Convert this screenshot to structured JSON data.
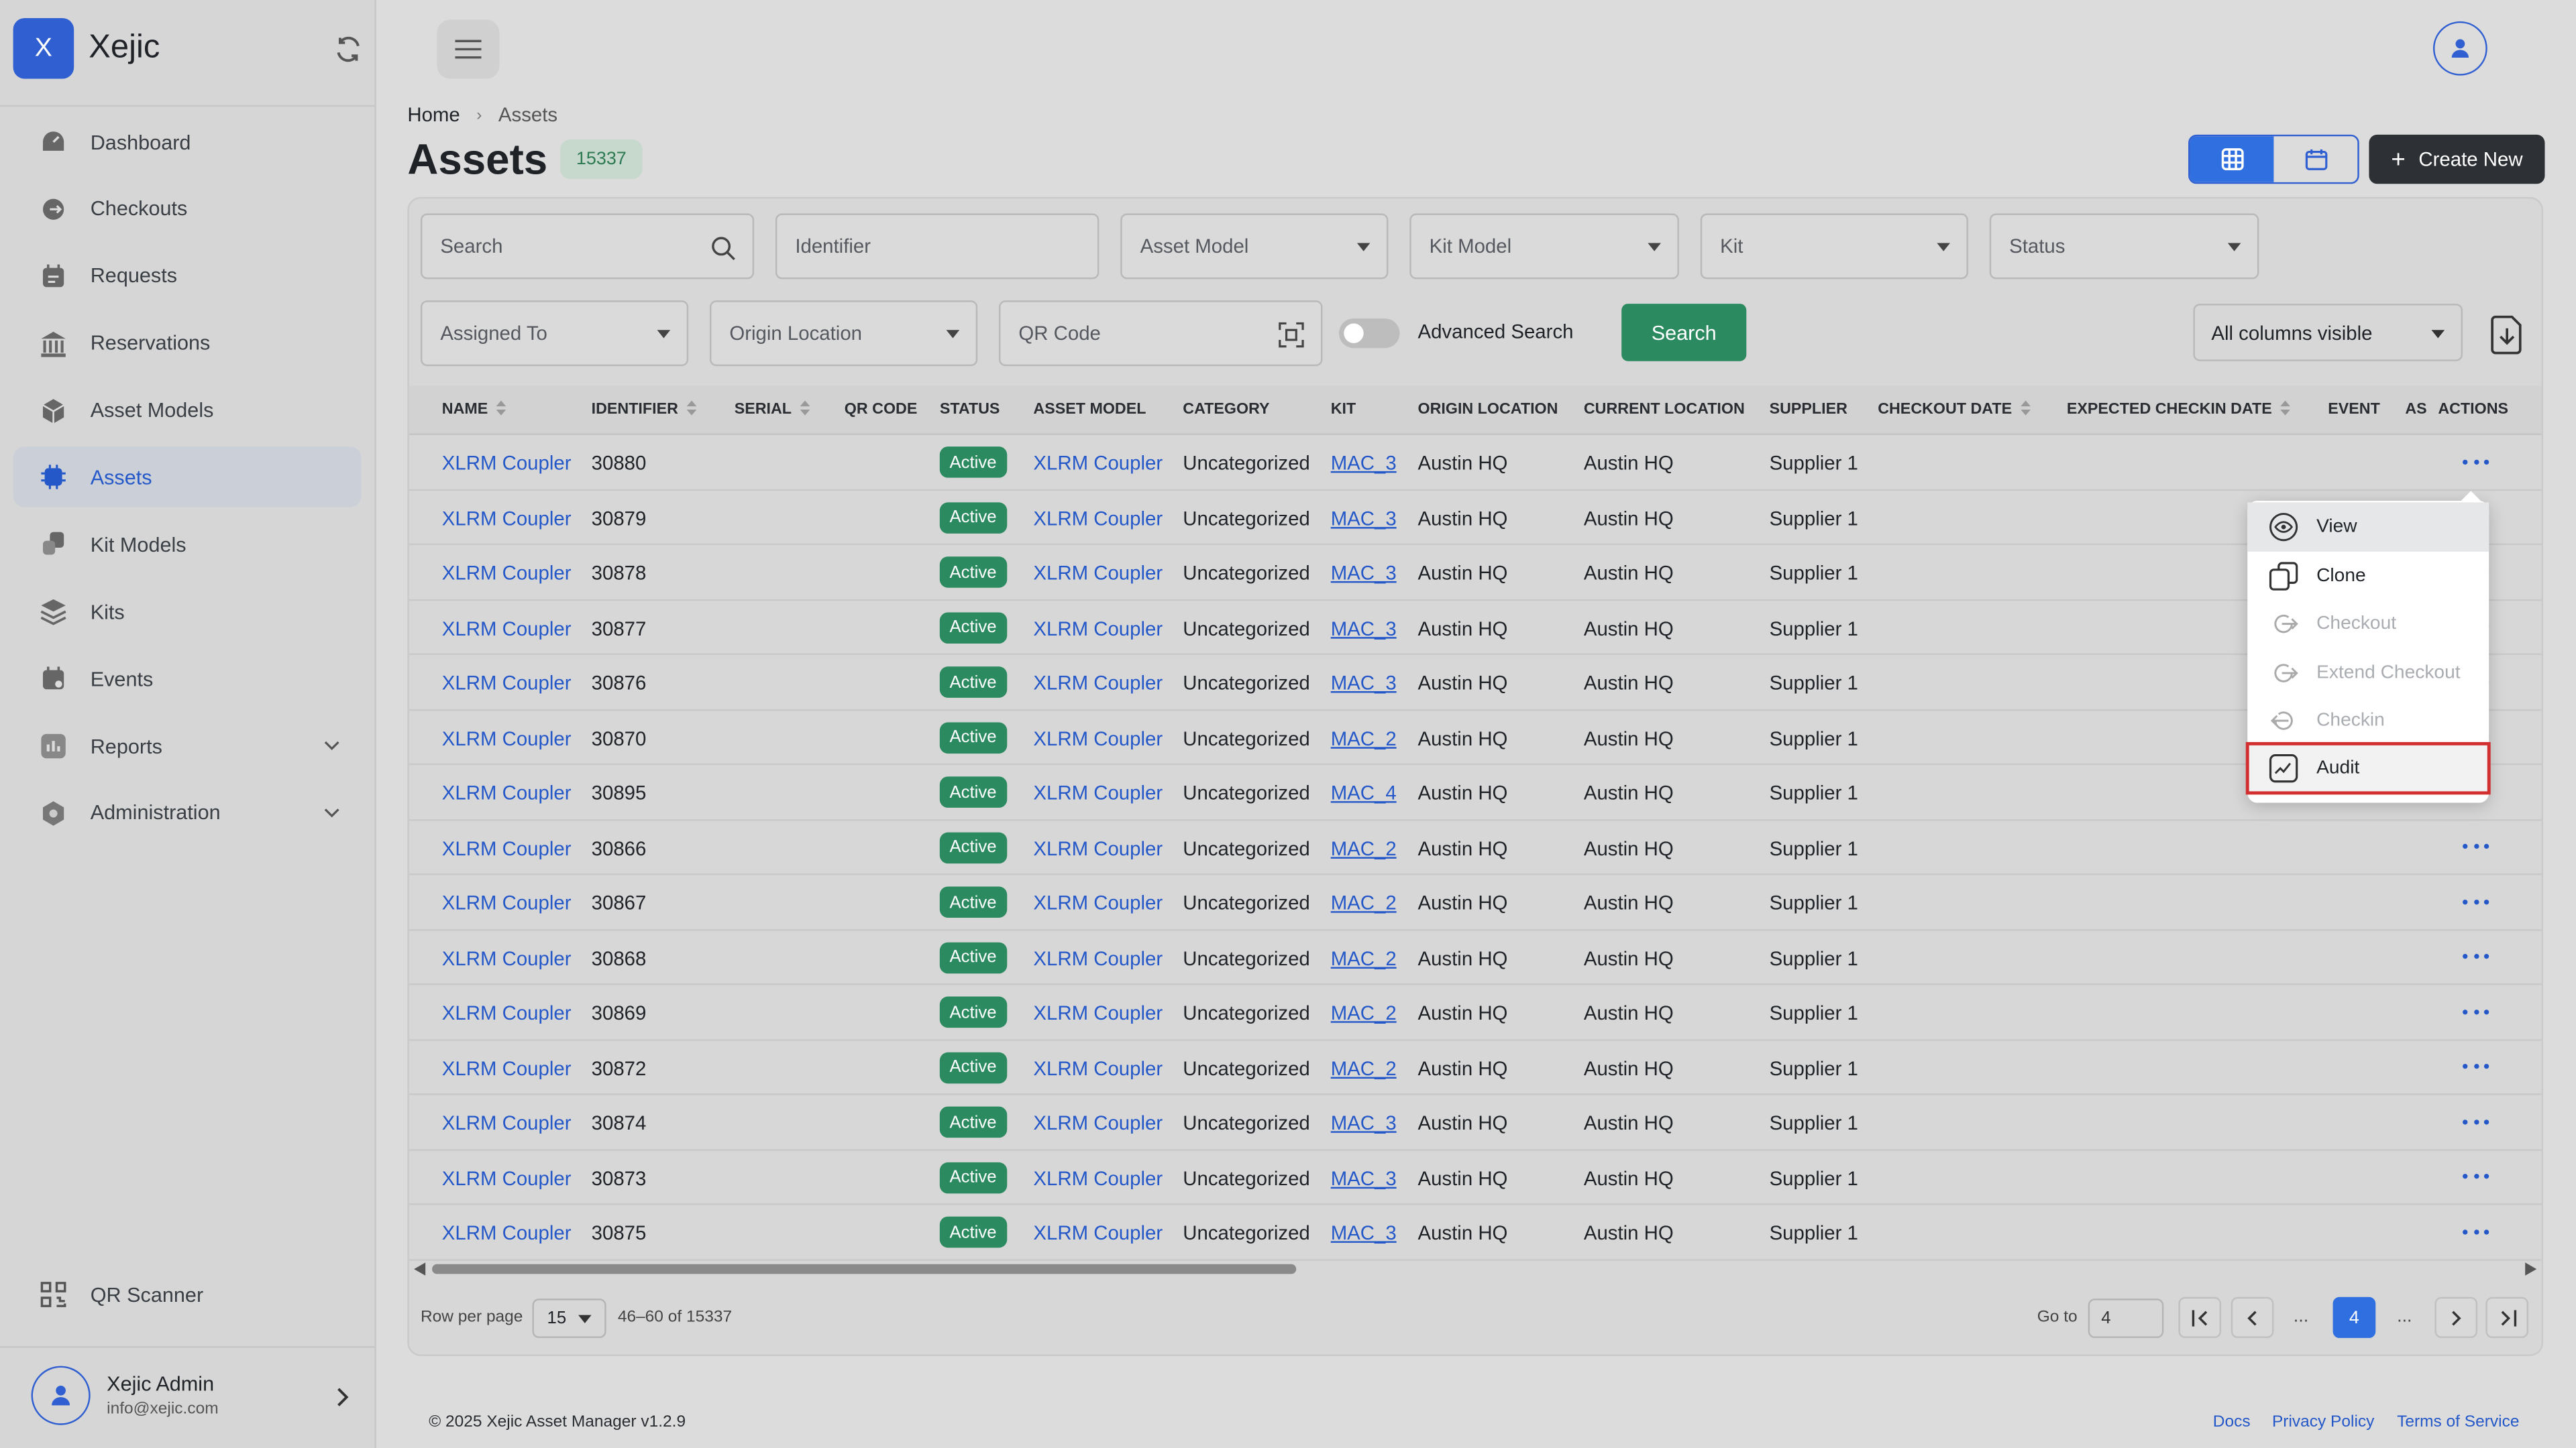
{
  "sidebar": {
    "brand_letter": "X",
    "brand_name": "Xejic",
    "items": [
      {
        "label": "Dashboard",
        "icon": "dashboard-icon"
      },
      {
        "label": "Checkouts",
        "icon": "checkouts-icon"
      },
      {
        "label": "Requests",
        "icon": "requests-icon"
      },
      {
        "label": "Reservations",
        "icon": "reservations-icon"
      },
      {
        "label": "Asset Models",
        "icon": "asset-models-icon"
      },
      {
        "label": "Assets",
        "icon": "assets-icon",
        "active": true
      },
      {
        "label": "Kit Models",
        "icon": "kit-models-icon"
      },
      {
        "label": "Kits",
        "icon": "kits-icon"
      },
      {
        "label": "Events",
        "icon": "events-icon"
      },
      {
        "label": "Reports",
        "icon": "reports-icon",
        "expandable": true
      },
      {
        "label": "Administration",
        "icon": "administration-icon",
        "expandable": true
      }
    ],
    "qr_scanner": "QR Scanner",
    "user_name": "Xejic Admin",
    "user_email": "info@xejic.com"
  },
  "breadcrumb": {
    "home": "Home",
    "current": "Assets"
  },
  "page": {
    "title": "Assets",
    "count": "15337",
    "create_label": "Create New"
  },
  "filters": {
    "search_placeholder": "Search",
    "identifier_placeholder": "Identifier",
    "asset_model": "Asset Model",
    "kit_model": "Kit Model",
    "kit": "Kit",
    "status": "Status",
    "assigned_to": "Assigned To",
    "origin_location": "Origin Location",
    "qr_code_placeholder": "QR Code",
    "advanced_search": "Advanced Search",
    "search_button": "Search",
    "columns_visible": "All columns visible"
  },
  "table": {
    "columns": [
      "NAME",
      "IDENTIFIER",
      "SERIAL",
      "QR CODE",
      "STATUS",
      "ASSET MODEL",
      "CATEGORY",
      "KIT",
      "ORIGIN LOCATION",
      "CURRENT LOCATION",
      "SUPPLIER",
      "CHECKOUT DATE",
      "EXPECTED CHECKIN DATE",
      "EVENT",
      "AS",
      "ACTIONS"
    ],
    "rows": [
      {
        "name": "XLRM Coupler",
        "identifier": "30880",
        "status": "Active",
        "model": "XLRM Coupler",
        "category": "Uncategorized",
        "kit": "MAC_3",
        "origin": "Austin HQ",
        "current": "Austin HQ",
        "supplier": "Supplier 1"
      },
      {
        "name": "XLRM Coupler",
        "identifier": "30879",
        "status": "Active",
        "model": "XLRM Coupler",
        "category": "Uncategorized",
        "kit": "MAC_3",
        "origin": "Austin HQ",
        "current": "Austin HQ",
        "supplier": "Supplier 1"
      },
      {
        "name": "XLRM Coupler",
        "identifier": "30878",
        "status": "Active",
        "model": "XLRM Coupler",
        "category": "Uncategorized",
        "kit": "MAC_3",
        "origin": "Austin HQ",
        "current": "Austin HQ",
        "supplier": "Supplier 1"
      },
      {
        "name": "XLRM Coupler",
        "identifier": "30877",
        "status": "Active",
        "model": "XLRM Coupler",
        "category": "Uncategorized",
        "kit": "MAC_3",
        "origin": "Austin HQ",
        "current": "Austin HQ",
        "supplier": "Supplier 1"
      },
      {
        "name": "XLRM Coupler",
        "identifier": "30876",
        "status": "Active",
        "model": "XLRM Coupler",
        "category": "Uncategorized",
        "kit": "MAC_3",
        "origin": "Austin HQ",
        "current": "Austin HQ",
        "supplier": "Supplier 1"
      },
      {
        "name": "XLRM Coupler",
        "identifier": "30870",
        "status": "Active",
        "model": "XLRM Coupler",
        "category": "Uncategorized",
        "kit": "MAC_2",
        "origin": "Austin HQ",
        "current": "Austin HQ",
        "supplier": "Supplier 1"
      },
      {
        "name": "XLRM Coupler",
        "identifier": "30895",
        "status": "Active",
        "model": "XLRM Coupler",
        "category": "Uncategorized",
        "kit": "MAC_4",
        "origin": "Austin HQ",
        "current": "Austin HQ",
        "supplier": "Supplier 1"
      },
      {
        "name": "XLRM Coupler",
        "identifier": "30866",
        "status": "Active",
        "model": "XLRM Coupler",
        "category": "Uncategorized",
        "kit": "MAC_2",
        "origin": "Austin HQ",
        "current": "Austin HQ",
        "supplier": "Supplier 1"
      },
      {
        "name": "XLRM Coupler",
        "identifier": "30867",
        "status": "Active",
        "model": "XLRM Coupler",
        "category": "Uncategorized",
        "kit": "MAC_2",
        "origin": "Austin HQ",
        "current": "Austin HQ",
        "supplier": "Supplier 1"
      },
      {
        "name": "XLRM Coupler",
        "identifier": "30868",
        "status": "Active",
        "model": "XLRM Coupler",
        "category": "Uncategorized",
        "kit": "MAC_2",
        "origin": "Austin HQ",
        "current": "Austin HQ",
        "supplier": "Supplier 1"
      },
      {
        "name": "XLRM Coupler",
        "identifier": "30869",
        "status": "Active",
        "model": "XLRM Coupler",
        "category": "Uncategorized",
        "kit": "MAC_2",
        "origin": "Austin HQ",
        "current": "Austin HQ",
        "supplier": "Supplier 1"
      },
      {
        "name": "XLRM Coupler",
        "identifier": "30872",
        "status": "Active",
        "model": "XLRM Coupler",
        "category": "Uncategorized",
        "kit": "MAC_2",
        "origin": "Austin HQ",
        "current": "Austin HQ",
        "supplier": "Supplier 1"
      },
      {
        "name": "XLRM Coupler",
        "identifier": "30874",
        "status": "Active",
        "model": "XLRM Coupler",
        "category": "Uncategorized",
        "kit": "MAC_3",
        "origin": "Austin HQ",
        "current": "Austin HQ",
        "supplier": "Supplier 1"
      },
      {
        "name": "XLRM Coupler",
        "identifier": "30873",
        "status": "Active",
        "model": "XLRM Coupler",
        "category": "Uncategorized",
        "kit": "MAC_3",
        "origin": "Austin HQ",
        "current": "Austin HQ",
        "supplier": "Supplier 1"
      },
      {
        "name": "XLRM Coupler",
        "identifier": "30875",
        "status": "Active",
        "model": "XLRM Coupler",
        "category": "Uncategorized",
        "kit": "MAC_3",
        "origin": "Austin HQ",
        "current": "Austin HQ",
        "supplier": "Supplier 1"
      }
    ]
  },
  "actions_menu": {
    "items": [
      {
        "label": "View",
        "icon": "eye-icon",
        "disabled": false
      },
      {
        "label": "Clone",
        "icon": "clone-icon",
        "disabled": false
      },
      {
        "label": "Checkout",
        "icon": "checkout-icon",
        "disabled": true
      },
      {
        "label": "Extend Checkout",
        "icon": "extend-checkout-icon",
        "disabled": true
      },
      {
        "label": "Checkin",
        "icon": "checkin-icon",
        "disabled": true
      },
      {
        "label": "Audit",
        "icon": "audit-icon",
        "disabled": false
      }
    ]
  },
  "pagination": {
    "rows_per_page_label": "Row per page",
    "rows_per_page": "15",
    "range": "46–60 of 15337",
    "goto_label": "Go to",
    "goto_value": "4",
    "current_page": "4",
    "ellipsis": "..."
  },
  "footer": {
    "copyright": "© 2025 Xejic Asset Manager v1.2.9",
    "docs": "Docs",
    "privacy": "Privacy Policy",
    "terms": "Terms of Service"
  },
  "colors": {
    "accent": "#2f6fe0",
    "status_active": "#2b8a5f",
    "highlight_outline": "#d23030"
  }
}
